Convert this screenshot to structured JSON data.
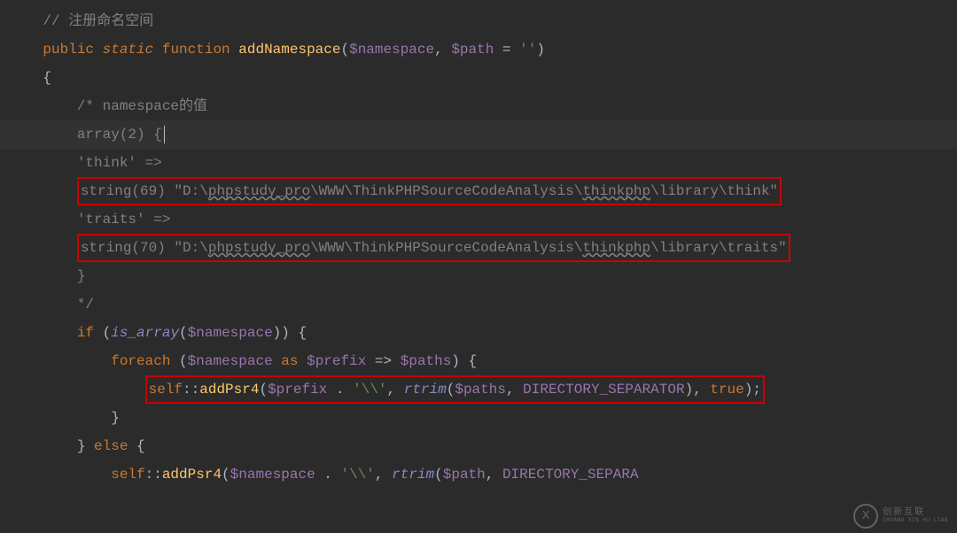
{
  "lines": {
    "l1_comment": "// 注册命名空间",
    "l2_public": "public",
    "l2_static": "static",
    "l2_function": "function",
    "l2_fname": "addNamespace",
    "l2_param1": "$namespace",
    "l2_param2": "$path",
    "l2_default": "''",
    "l3_brace": "{",
    "l4_comment": "/* namespace的值",
    "l5_array": "array(2) {",
    "l6_think": "'think' =>",
    "l7_string": "string(69) \"D:\\",
    "l7_phpstudy": "phpstudy_pro",
    "l7_mid": "\\WWW\\ThinkPHPSourceCodeAnalysis\\",
    "l7_thinkphp": "thinkphp",
    "l7_end": "\\library\\think\"",
    "l8_traits": "'traits' =>",
    "l9_string": "string(70) \"D:\\",
    "l9_phpstudy": "phpstudy_pro",
    "l9_mid": "\\WWW\\ThinkPHPSourceCodeAnalysis\\",
    "l9_thinkphp": "thinkphp",
    "l9_end": "\\library\\traits\"",
    "l10_brace": "}",
    "l11_end": "*/",
    "l12_if": "if",
    "l12_isarray": "is_array",
    "l12_var": "$namespace",
    "l13_foreach": "foreach",
    "l13_var1": "$namespace",
    "l13_as": "as",
    "l13_var2": "$prefix",
    "l13_arrow": "=>",
    "l13_var3": "$paths",
    "l14_self": "self",
    "l14_method": "addPsr4",
    "l14_prefix": "$prefix",
    "l14_concat": ".",
    "l14_str": "'\\\\'",
    "l14_rtrim": "rtrim",
    "l14_paths": "$paths",
    "l14_const": "DIRECTORY_SEPARATOR",
    "l14_true": "true",
    "l15_brace": "}",
    "l16_brace": "}",
    "l16_else": "else",
    "l17_self": "self",
    "l17_method": "addPsr4",
    "l17_var": "$namespace",
    "l17_str": "'\\\\'",
    "l17_rtrim": "rtrim",
    "l17_path": "$path",
    "l17_const": "DIRECTORY_SEPARA"
  },
  "watermark": {
    "cn": "创新互联",
    "en": "CHUANG XIN HU LIAN"
  }
}
